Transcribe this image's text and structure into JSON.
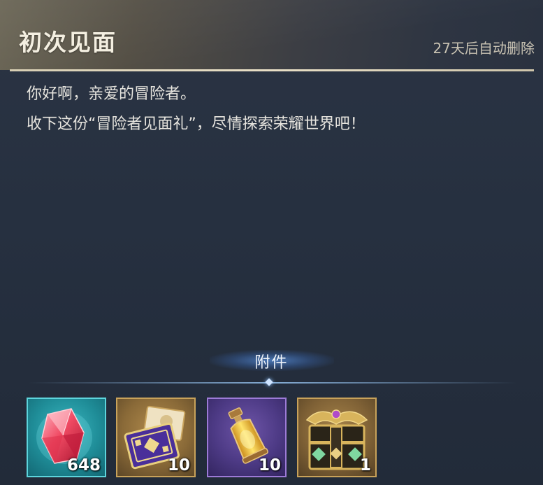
{
  "mail": {
    "title": "初次见面",
    "expire_text": "27天后自动删除",
    "body_lines": [
      "你好啊，亲爱的冒险者。",
      "收下这份“冒险者见面礼”，尽情探索荣耀世界吧！"
    ]
  },
  "attachments": {
    "label": "附件",
    "items": [
      {
        "icon": "red-crystal-icon",
        "count": "648",
        "frame_color": "#5dd4dc"
      },
      {
        "icon": "purple-voucher-icon",
        "count": "10",
        "frame_color": "#c8a25a"
      },
      {
        "icon": "golden-potion-icon",
        "count": "10",
        "frame_color": "#9c7ad6"
      },
      {
        "icon": "treasure-chest-icon",
        "count": "1",
        "frame_color": "#c8a25a"
      }
    ]
  },
  "colors": {
    "background": "#263040",
    "title_text": "#f4efe1",
    "accent_line": "#e8dfc6",
    "attachment_glow": "#568edc"
  }
}
